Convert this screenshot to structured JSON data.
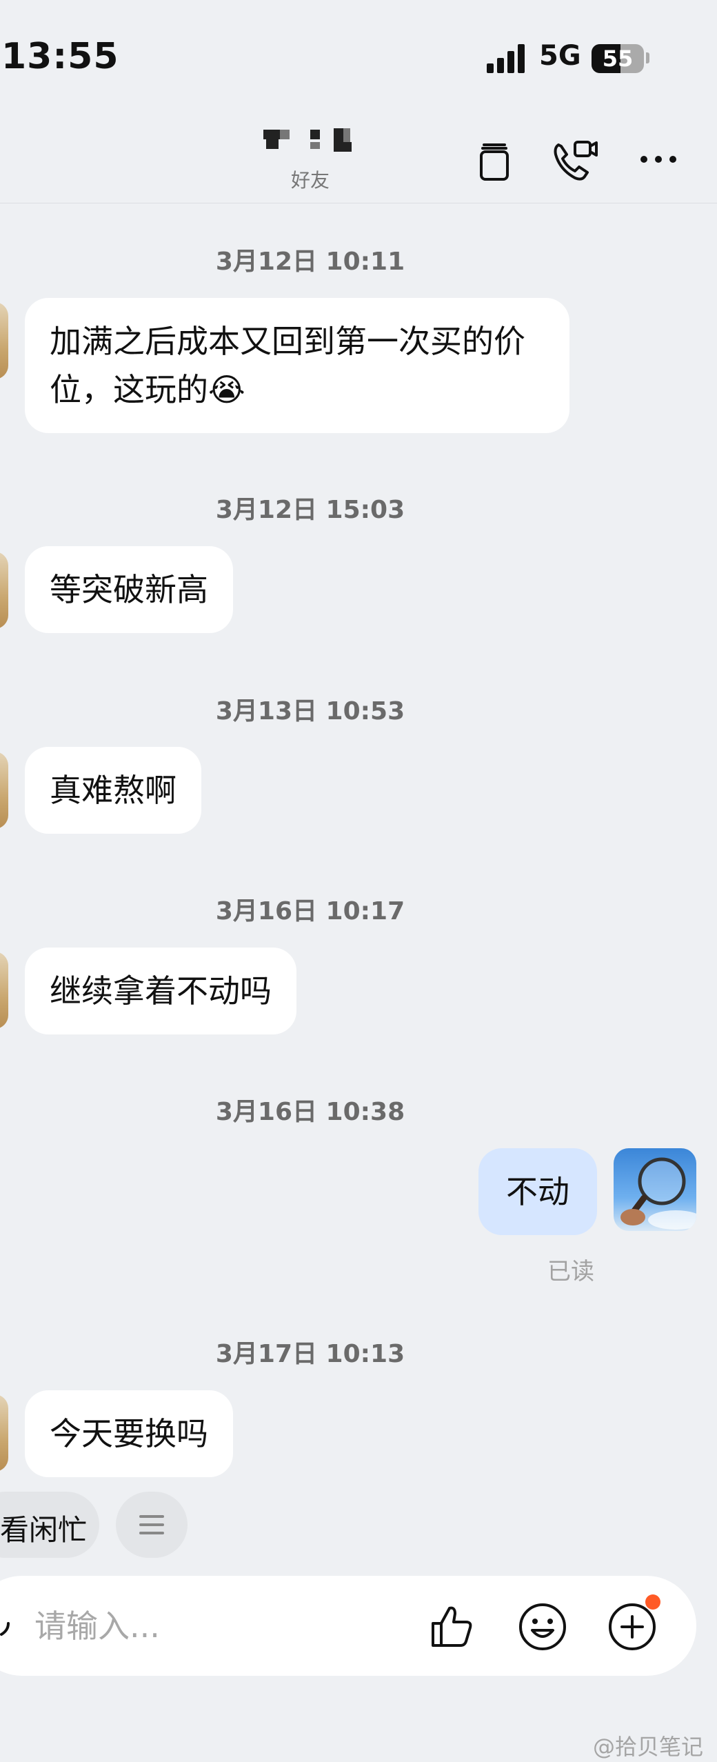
{
  "status_bar": {
    "time": "13:55",
    "network": "5G",
    "battery": "55",
    "battery_level": 0.55
  },
  "header": {
    "contact_subtitle": "好友"
  },
  "messages": [
    {
      "timestamp": "3月12日 10:11",
      "text": "加满之后成本又回到第一次买的价位，这玩的😭",
      "sender": "friend"
    },
    {
      "timestamp": "3月12日 15:03",
      "text": "等突破新高",
      "sender": "friend"
    },
    {
      "timestamp": "3月13日 10:53",
      "text": "真难熬啊",
      "sender": "friend"
    },
    {
      "timestamp": "3月16日 10:17",
      "text": "继续拿着不动吗",
      "sender": "friend"
    },
    {
      "timestamp": "3月16日 10:38",
      "text": "不动",
      "sender": "me",
      "status": "已读"
    },
    {
      "timestamp": "3月17日 10:13",
      "text": "今天要换吗",
      "sender": "friend"
    }
  ],
  "quick_replies": {
    "item_1": "看闲忙"
  },
  "input": {
    "placeholder": "请输入..."
  },
  "icons": {
    "header": [
      "copy-icon",
      "video-call-icon",
      "more-icon"
    ],
    "input": [
      "thumbs-up-icon",
      "emoji-icon",
      "add-icon"
    ]
  },
  "colors": {
    "background": "#eef0f3",
    "friend_bubble": "#ffffff",
    "my_bubble": "#d6e6ff",
    "badge": "#ff5a26"
  },
  "watermark": "@拾贝笔记"
}
